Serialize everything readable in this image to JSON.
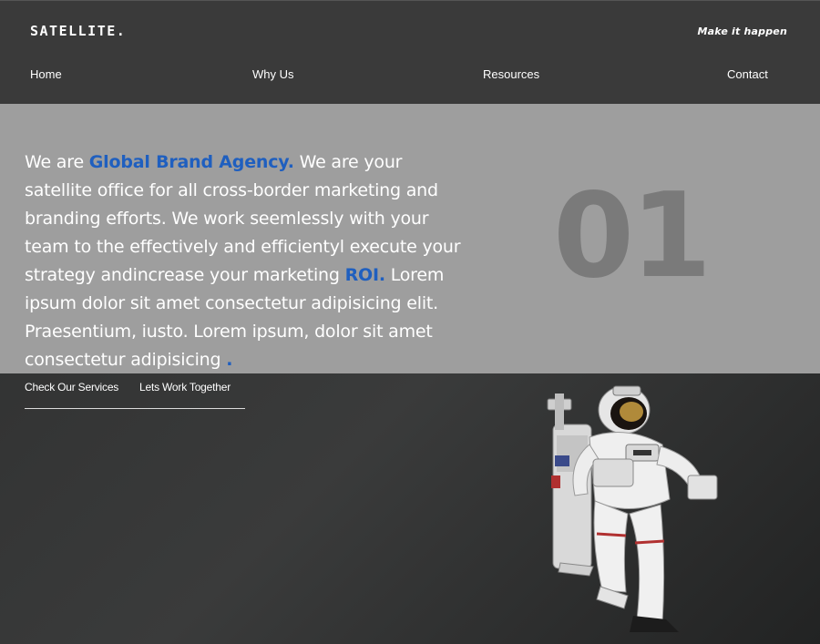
{
  "header": {
    "logo": "SATELLITE.",
    "tagline": "Make it happen"
  },
  "nav": {
    "items": [
      "Home",
      "Why Us",
      "Resources",
      "Contact"
    ]
  },
  "hero": {
    "intro": "We are ",
    "highlight1": "Global Brand Agency.",
    "body1": " We are your satellite office for all cross-border marketing and branding efforts. We work seemlessly with your team to the effectively and efficientyl execute your strategy andincrease your marketing ",
    "highlight2": "ROI.",
    "body2": " Lorem ipsum dolor sit amet consectetur adipisicing elit. Praesentium, iusto. Lorem ipsum, dolor sit amet consectetur adipisicing ",
    "highlight3": ".",
    "number": "01"
  },
  "cta": {
    "primary": "Check Our Services",
    "secondary": "Lets Work Together"
  },
  "colors": {
    "accent": "#1f5fbf",
    "hero_bg": "#9e9e9e",
    "header_bg": "#3a3a3a"
  }
}
